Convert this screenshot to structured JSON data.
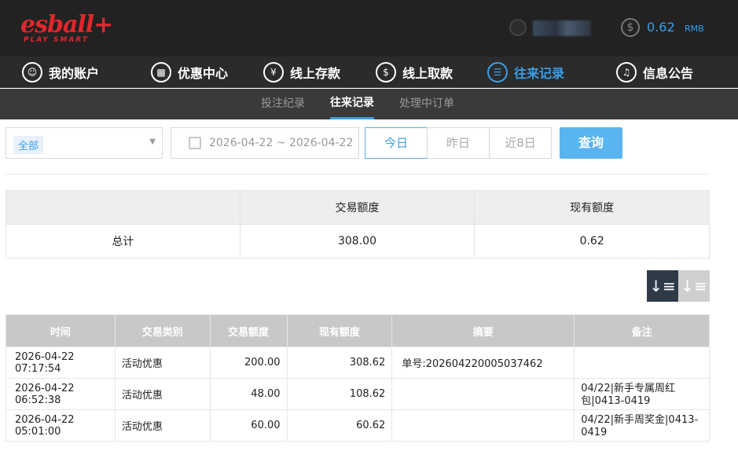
{
  "header": {
    "logo_text": "esball+",
    "logo_tagline": "PLAY SMART",
    "balance_amount": "0.62",
    "balance_unit": "RMB",
    "accent_color": "#3c9ee5",
    "brand_color": "#e0272c"
  },
  "nav": {
    "items": [
      {
        "label": "我的账户",
        "icon": "user-icon"
      },
      {
        "label": "优惠中心",
        "icon": "gift-icon"
      },
      {
        "label": "线上存款",
        "icon": "deposit-icon"
      },
      {
        "label": "线上取款",
        "icon": "withdraw-icon"
      },
      {
        "label": "往来记录",
        "icon": "record-icon"
      },
      {
        "label": "信息公告",
        "icon": "bell-icon"
      }
    ]
  },
  "subnav": {
    "items": [
      "投注纪录",
      "往来记录",
      "处理中订单"
    ]
  },
  "filters": {
    "type_selected": "全部",
    "date_range": "2026-04-22 ~ 2026-04-22",
    "quick": [
      "今日",
      "昨日",
      "近8日"
    ],
    "query_label": "查询"
  },
  "summary": {
    "headers": [
      "",
      "交易额度",
      "现有额度"
    ],
    "row": [
      "总计",
      "308.00",
      "0.62"
    ]
  },
  "table": {
    "headers": [
      "时间",
      "交易类别",
      "交易额度",
      "现有额度",
      "摘要",
      "备注"
    ],
    "rows": [
      [
        "2026-04-22 07:17:54",
        "活动优惠",
        "200.00",
        "308.62",
        "单号:202604220005037462",
        ""
      ],
      [
        "2026-04-22 06:52:38",
        "活动优惠",
        "48.00",
        "108.62",
        "",
        "04/22|新手专属周红包|0413-0419"
      ],
      [
        "2026-04-22 05:01:00",
        "活动优惠",
        "60.00",
        "60.62",
        "",
        "04/22|新手周奖金|0413-0419"
      ]
    ]
  }
}
